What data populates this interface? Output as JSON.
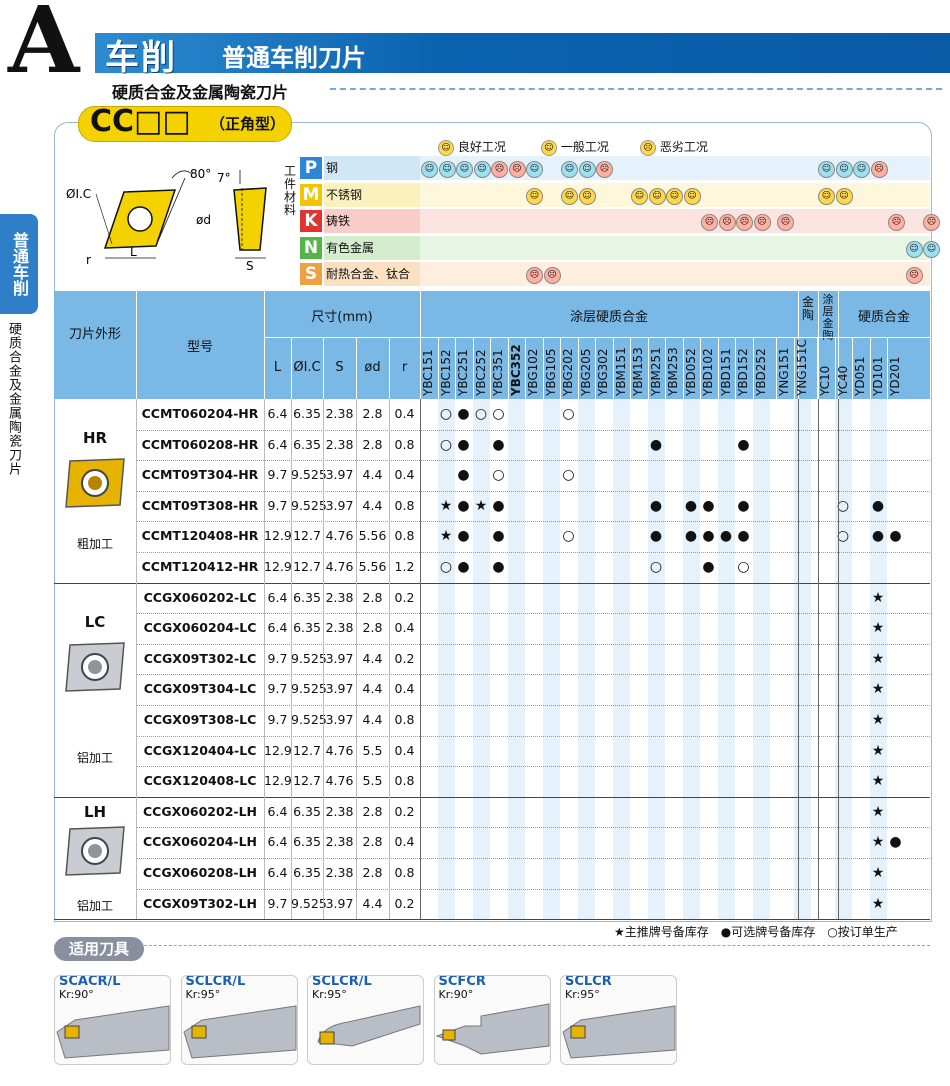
{
  "header": {
    "letter": "A",
    "title": "车削",
    "subtitle": "普通车削刀片",
    "subtitle2": "硬质合金及金属陶瓷刀片",
    "side_tab": "普通车削",
    "side_sub": "硬质合金及金属陶瓷刀片"
  },
  "badge": {
    "code": "CC□□",
    "type": "（正角型）"
  },
  "diagram": {
    "ic": "ØI.C",
    "angle1": "80°",
    "angle2": "7°",
    "d": "ød",
    "r": "r",
    "L": "L",
    "S": "S"
  },
  "legend": {
    "good": "良好工况",
    "avg": "一般工况",
    "bad": "恶劣工况",
    "good_icon": "smile-face",
    "avg_icon": "neutral-face",
    "bad_icon": "sad-face"
  },
  "material_header": "工件材料",
  "materials": [
    {
      "letter": "P",
      "name": "钢",
      "color": "#2f86d6",
      "bg": "#cfe6f7"
    },
    {
      "letter": "M",
      "name": "不锈钢",
      "color": "#f2c500",
      "bg": "#fbf1bd"
    },
    {
      "letter": "K",
      "name": "铸铁",
      "color": "#e0342e",
      "bg": "#f8cdc7"
    },
    {
      "letter": "N",
      "name": "有色金属",
      "color": "#55b548",
      "bg": "#d3edcd"
    },
    {
      "letter": "S",
      "name": "耐热合金、钛合金",
      "color": "#f0a040",
      "bg": "#fbe0c2"
    }
  ],
  "material_faces": {
    "P": [
      [
        0,
        "g"
      ],
      [
        1,
        "g"
      ],
      [
        2,
        "g"
      ],
      [
        3,
        "g"
      ],
      [
        4,
        "b"
      ],
      [
        5,
        "b"
      ],
      [
        6,
        "g"
      ],
      [
        8,
        "g"
      ],
      [
        9,
        "g"
      ],
      [
        10,
        "b"
      ],
      [
        22,
        "g"
      ],
      [
        23,
        "g"
      ],
      [
        24,
        "g"
      ],
      [
        25,
        "b"
      ]
    ],
    "M": [
      [
        6,
        "a"
      ],
      [
        8,
        "a"
      ],
      [
        9,
        "a"
      ],
      [
        12,
        "a"
      ],
      [
        13,
        "a"
      ],
      [
        14,
        "a"
      ],
      [
        15,
        "a"
      ],
      [
        22,
        "a"
      ],
      [
        23,
        "a"
      ]
    ],
    "K": [
      [
        16,
        "b"
      ],
      [
        17,
        "b"
      ],
      [
        18,
        "b"
      ],
      [
        19,
        "b"
      ],
      [
        20,
        "b"
      ],
      [
        26,
        "b"
      ],
      [
        28,
        "b"
      ]
    ],
    "N": [
      [
        27,
        "g"
      ],
      [
        28,
        "g"
      ]
    ],
    "S": [
      [
        6,
        "b"
      ],
      [
        7,
        "b"
      ],
      [
        27,
        "b"
      ]
    ]
  },
  "table": {
    "h_shape": "刀片外形",
    "h_model": "型号",
    "h_dims": "尺寸(mm)",
    "h_cols": [
      "L",
      "ØI.C",
      "S",
      "ød",
      "r"
    ],
    "h_coated": "涂层硬质合金",
    "h_cermet": "金陶",
    "h_coated_cermet": "涂层金陶",
    "h_carbide": "硬质合金",
    "brands": [
      "YBC151",
      "YBC152",
      "YBC251",
      "YBC252",
      "YBC351",
      "YBC352",
      "YBG102",
      "YBG105",
      "YBG202",
      "YBG205",
      "YBG302",
      "YBM151",
      "YBM153",
      "YBM251",
      "YBM253",
      "YBD052",
      "YBD102",
      "YBD151",
      "YBD152",
      "YBD252",
      "YNG151",
      "YNG151C",
      "YC10",
      "YC40",
      "YD051",
      "YD101",
      "YD201"
    ],
    "groups": [
      {
        "name": "HR",
        "desc": "粗加工",
        "rows": [
          {
            "model": "CCMT060204-HR",
            "L": "6.4",
            "IC": "6.35",
            "S": "2.38",
            "d": "2.8",
            "r": "0.4",
            "marks": [
              [
                1,
                "o"
              ],
              [
                2,
                "d"
              ],
              [
                3,
                "o"
              ],
              [
                4,
                "o"
              ],
              [
                8,
                "o"
              ]
            ]
          },
          {
            "model": "CCMT060208-HR",
            "L": "6.4",
            "IC": "6.35",
            "S": "2.38",
            "d": "2.8",
            "r": "0.8",
            "marks": [
              [
                1,
                "o"
              ],
              [
                2,
                "d"
              ],
              [
                4,
                "d"
              ],
              [
                13,
                "d"
              ],
              [
                18,
                "d"
              ]
            ]
          },
          {
            "model": "CCMT09T304-HR",
            "L": "9.7",
            "IC": "9.525",
            "S": "3.97",
            "d": "4.4",
            "r": "0.4",
            "marks": [
              [
                2,
                "d"
              ],
              [
                4,
                "o"
              ],
              [
                8,
                "o"
              ]
            ]
          },
          {
            "model": "CCMT09T308-HR",
            "L": "9.7",
            "IC": "9.525",
            "S": "3.97",
            "d": "4.4",
            "r": "0.8",
            "marks": [
              [
                1,
                "s"
              ],
              [
                2,
                "d"
              ],
              [
                3,
                "s"
              ],
              [
                4,
                "d"
              ],
              [
                13,
                "d"
              ],
              [
                15,
                "d"
              ],
              [
                16,
                "d"
              ],
              [
                18,
                "d"
              ],
              [
                23,
                "o"
              ],
              [
                25,
                "d"
              ]
            ]
          },
          {
            "model": "CCMT120408-HR",
            "L": "12.9",
            "IC": "12.7",
            "S": "4.76",
            "d": "5.56",
            "r": "0.8",
            "marks": [
              [
                1,
                "s"
              ],
              [
                2,
                "d"
              ],
              [
                4,
                "d"
              ],
              [
                8,
                "o"
              ],
              [
                13,
                "d"
              ],
              [
                15,
                "d"
              ],
              [
                16,
                "d"
              ],
              [
                17,
                "d"
              ],
              [
                18,
                "d"
              ],
              [
                23,
                "o"
              ],
              [
                25,
                "d"
              ],
              [
                26,
                "d"
              ]
            ]
          },
          {
            "model": "CCMT120412-HR",
            "L": "12.9",
            "IC": "12.7",
            "S": "4.76",
            "d": "5.56",
            "r": "1.2",
            "marks": [
              [
                1,
                "o"
              ],
              [
                2,
                "d"
              ],
              [
                4,
                "d"
              ],
              [
                13,
                "o"
              ],
              [
                16,
                "d"
              ],
              [
                18,
                "o"
              ]
            ]
          }
        ]
      },
      {
        "name": "LC",
        "desc": "铝加工",
        "rows": [
          {
            "model": "CCGX060202-LC",
            "L": "6.4",
            "IC": "6.35",
            "S": "2.38",
            "d": "2.8",
            "r": "0.2",
            "marks": [
              [
                25,
                "s"
              ]
            ]
          },
          {
            "model": "CCGX060204-LC",
            "L": "6.4",
            "IC": "6.35",
            "S": "2.38",
            "d": "2.8",
            "r": "0.4",
            "marks": [
              [
                25,
                "s"
              ]
            ]
          },
          {
            "model": "CCGX09T302-LC",
            "L": "9.7",
            "IC": "9.525",
            "S": "3.97",
            "d": "4.4",
            "r": "0.2",
            "marks": [
              [
                25,
                "s"
              ]
            ]
          },
          {
            "model": "CCGX09T304-LC",
            "L": "9.7",
            "IC": "9.525",
            "S": "3.97",
            "d": "4.4",
            "r": "0.4",
            "marks": [
              [
                25,
                "s"
              ]
            ]
          },
          {
            "model": "CCGX09T308-LC",
            "L": "9.7",
            "IC": "9.525",
            "S": "3.97",
            "d": "4.4",
            "r": "0.8",
            "marks": [
              [
                25,
                "s"
              ]
            ]
          },
          {
            "model": "CCGX120404-LC",
            "L": "12.9",
            "IC": "12.7",
            "S": "4.76",
            "d": "5.5",
            "r": "0.4",
            "marks": [
              [
                25,
                "s"
              ]
            ]
          },
          {
            "model": "CCGX120408-LC",
            "L": "12.9",
            "IC": "12.7",
            "S": "4.76",
            "d": "5.5",
            "r": "0.8",
            "marks": [
              [
                25,
                "s"
              ]
            ]
          }
        ]
      },
      {
        "name": "LH",
        "desc": "铝加工",
        "rows": [
          {
            "model": "CCGX060202-LH",
            "L": "6.4",
            "IC": "6.35",
            "S": "2.38",
            "d": "2.8",
            "r": "0.2",
            "marks": [
              [
                25,
                "s"
              ]
            ]
          },
          {
            "model": "CCGX060204-LH",
            "L": "6.4",
            "IC": "6.35",
            "S": "2.38",
            "d": "2.8",
            "r": "0.4",
            "marks": [
              [
                25,
                "s"
              ],
              [
                26,
                "d"
              ]
            ]
          },
          {
            "model": "CCGX060208-LH",
            "L": "6.4",
            "IC": "6.35",
            "S": "2.38",
            "d": "2.8",
            "r": "0.8",
            "marks": [
              [
                25,
                "s"
              ]
            ]
          },
          {
            "model": "CCGX09T302-LH",
            "L": "9.7",
            "IC": "9.525",
            "S": "3.97",
            "d": "4.4",
            "r": "0.2",
            "marks": [
              [
                25,
                "s"
              ]
            ]
          }
        ]
      }
    ]
  },
  "footer_legend": "★主推牌号备库存　●可选牌号备库存　○按订单生产",
  "tools": {
    "title": "适用刀具",
    "items": [
      {
        "name": "SCACR/L",
        "kr": "Kr:90°"
      },
      {
        "name": "SCLCR/L",
        "kr": "Kr:95°"
      },
      {
        "name": "SCLCR/L",
        "kr": "Kr:95°"
      },
      {
        "name": "SCFCR",
        "kr": "Kr:90°"
      },
      {
        "name": "SCLCR",
        "kr": "Kr:95°"
      }
    ]
  },
  "colors": {
    "header_blue": "#0b63b0",
    "table_head": "#7ab8e6",
    "stripe": "#e6f2fb",
    "badge": "#f4d200"
  }
}
